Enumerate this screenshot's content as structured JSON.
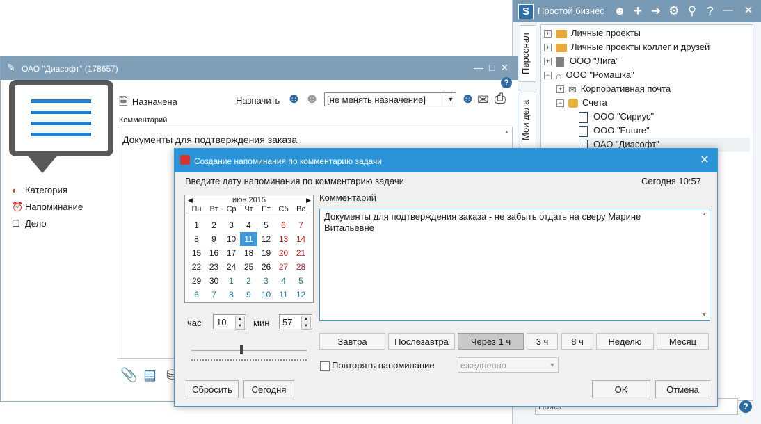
{
  "main_window": {
    "title": "Простой бизнес",
    "logo": "S",
    "toolbar_icons": [
      "user-icon",
      "plus-icon",
      "arrow-right-icon",
      "gear-icon",
      "search-icon",
      "help-icon"
    ],
    "side_tabs": [
      "Персонал",
      "Мои дела"
    ],
    "tree": [
      {
        "label": "Личные проекты",
        "icon": "briefcase-icon"
      },
      {
        "label": "Личные проекты коллег и друзей",
        "icon": "briefcase-icon"
      },
      {
        "label": "ООО \"Лига\"",
        "icon": "building-icon"
      },
      {
        "label": "ООО \"Ромашка\"",
        "icon": "house-icon"
      },
      {
        "label": "Корпоративная почта",
        "icon": "envelope-icon"
      },
      {
        "label": "Счета",
        "icon": "accounts-icon"
      },
      {
        "label": "ООО \"Сириус\"",
        "icon": "document-icon"
      },
      {
        "label": "ООО \"Future\"",
        "icon": "document-icon"
      },
      {
        "label": "ОАО \"Диасофт\"",
        "icon": "document-icon"
      }
    ],
    "search_placeholder": "Поиск"
  },
  "task_window": {
    "title": "ОАО \"Диасофт\" (178657)",
    "status": "Назначена",
    "assign_label": "Назначить",
    "assign_select": "[не менять назначение]",
    "comment_label": "Комментарий",
    "comment_text": "Документы для подтверждения заказа",
    "side_options": {
      "category": "Категория",
      "reminder": "Напоминание",
      "task": "Дело"
    }
  },
  "reminder_dialog": {
    "title": "Создание напоминания по комментарию задачи",
    "prompt": "Введите дату напоминания по комментарию задачи",
    "today_label": "Сегодня 10:57",
    "calendar": {
      "month": "июн 2015",
      "weekdays": [
        "Пн",
        "Вт",
        "Ср",
        "Чт",
        "Пт",
        "Сб",
        "Вс"
      ],
      "weeks": [
        [
          "1",
          "2",
          "3",
          "4",
          "5",
          "6",
          "7"
        ],
        [
          "8",
          "9",
          "10",
          "11",
          "12",
          "13",
          "14"
        ],
        [
          "15",
          "16",
          "17",
          "18",
          "19",
          "20",
          "21"
        ],
        [
          "22",
          "23",
          "24",
          "25",
          "26",
          "27",
          "28"
        ],
        [
          "29",
          "30",
          "1",
          "2",
          "3",
          "4",
          "5"
        ],
        [
          "6",
          "7",
          "8",
          "9",
          "10",
          "11",
          "12"
        ]
      ],
      "selected": "11"
    },
    "hour_label": "час",
    "hour_value": "10",
    "min_label": "мин",
    "min_value": "57",
    "comment_label": "Комментарий",
    "comment_text": "Документы для подтверждения заказа - не забыть отдать на сверу Марине Витальевне",
    "quick_buttons": [
      "Завтра",
      "Послезавтра",
      "Через 1 ч",
      "3 ч",
      "8 ч",
      "Неделю",
      "Месяц"
    ],
    "active_quick": "Через 1 ч",
    "repeat_label": "Повторять напоминание",
    "repeat_value": "ежедневно",
    "reset_label": "Сбросить",
    "today_btn": "Сегодня",
    "ok_label": "OK",
    "cancel_label": "Отмена"
  }
}
